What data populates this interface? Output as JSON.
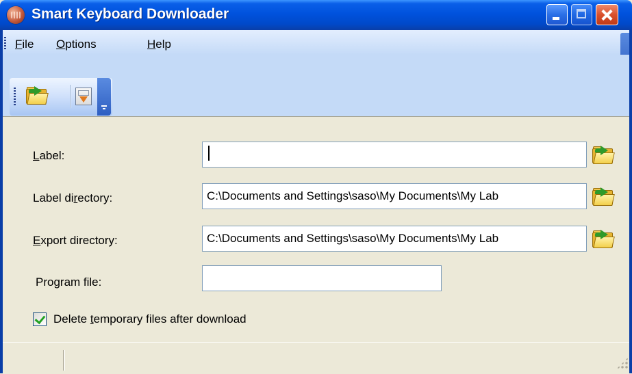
{
  "window": {
    "title": "Smart Keyboard Downloader",
    "icon": "keyboard-app-icon",
    "controls": [
      "minimize",
      "maximize",
      "close"
    ]
  },
  "menu": {
    "file": "File",
    "options": "Options",
    "help": "Help"
  },
  "toolbar": {
    "buttons": [
      "open-folder-icon",
      "download-icon"
    ]
  },
  "form": {
    "label": {
      "label": "Label:",
      "value": ""
    },
    "label_directory": {
      "label": "Label directory:",
      "value": "C:\\Documents and Settings\\saso\\My Documents\\My Lab"
    },
    "export_directory": {
      "label": "Export directory:",
      "value": "C:\\Documents and Settings\\saso\\My Documents\\My Lab"
    },
    "program_file": {
      "label": "Program file:",
      "value": ""
    },
    "delete_temp": {
      "label": "Delete temporary files after download",
      "checked": true
    }
  },
  "colors": {
    "titlebar": "#0052dd",
    "menubar": "#c4daf7",
    "dialog_bg": "#ece9d8",
    "close_button": "#d9502c"
  }
}
